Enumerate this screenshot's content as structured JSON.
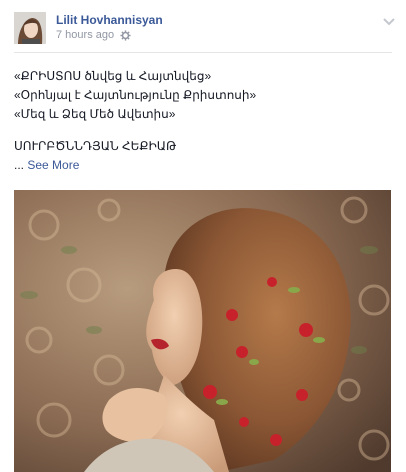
{
  "post": {
    "author": "Lilit Hovhannisyan",
    "timestamp": "7 hours ago",
    "privacy_icon": "gear-icon",
    "options_icon": "chevron-down-icon",
    "text_lines": [
      "«ՔՐԻՍՏՈՍ ծնվեց և Հայտնվեց»",
      "«Օրհնյալ է Հայտնությունը Քրիստոսի»",
      "«Մեզ և Ձեզ Մեծ Ավետիս»"
    ],
    "text_after_break": "ՍՈՒՐԲԾՆՆԴՅԱՆ ՀԵՔԻԱԹ",
    "see_more_prefix": "...",
    "see_more_label": "See More"
  },
  "colors": {
    "link": "#3b5998",
    "meta": "#9197a3",
    "text": "#141823"
  }
}
